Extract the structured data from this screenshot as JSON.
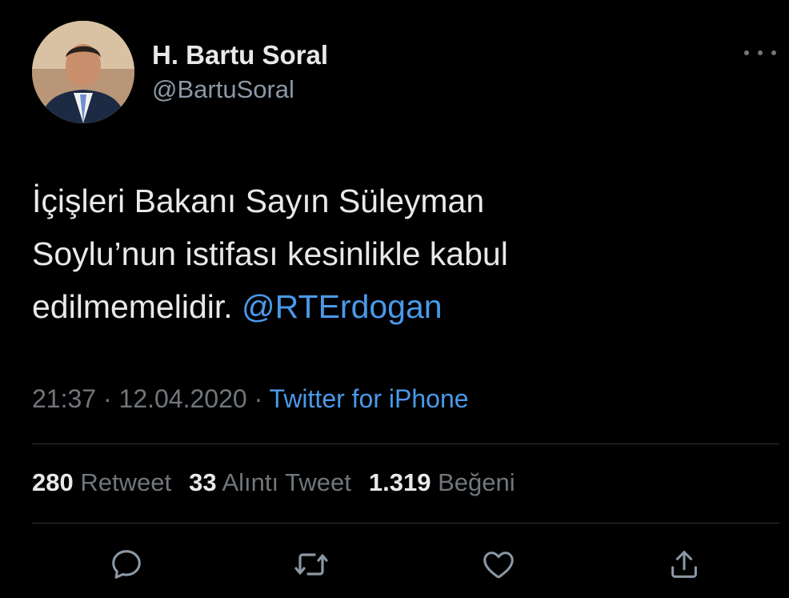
{
  "author": {
    "display_name": "H. Bartu Soral",
    "handle": "@BartuSoral"
  },
  "tweet": {
    "text_line1": "İçişleri Bakanı Sayın Süleyman",
    "text_line2": "Soylu’nun istifası kesinlikle kabul",
    "text_line3": "edilmemelidir. ",
    "mention": "@RTErdogan"
  },
  "meta": {
    "time": "21:37",
    "separator1": " · ",
    "date": "12.04.2020",
    "separator2": " · ",
    "source": "Twitter for iPhone"
  },
  "stats": {
    "retweets_count": "280",
    "retweets_label": "Retweet",
    "quotes_count": "33",
    "quotes_label": "Alıntı Tweet",
    "likes_count": "1.319",
    "likes_label": "Beğeni"
  },
  "icons": {
    "more": "more-horizontal-icon",
    "reply": "reply-icon",
    "retweet": "retweet-icon",
    "like": "heart-icon",
    "share": "share-icon"
  },
  "colors": {
    "background": "#000000",
    "text": "#e7e9ea",
    "secondary": "#71767b",
    "link": "#4a99e9",
    "divider": "#2f3336"
  }
}
